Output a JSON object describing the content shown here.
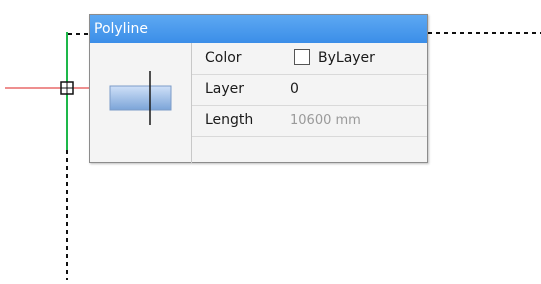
{
  "tooltip": {
    "title": "Polyline",
    "properties": [
      {
        "name": "Color",
        "value": "ByLayer",
        "swatch_color": "#ffffff"
      },
      {
        "name": "Layer",
        "value": "0"
      },
      {
        "name": "Length",
        "value": "10600 mm"
      }
    ]
  },
  "colors": {
    "header_accent": "#3b8ee8",
    "selected_polyline": "#1db84a",
    "red_axis": "#e86a6a",
    "dashed_line": "#111111"
  },
  "icons": {
    "thumbnail": "polyline-thumbnail-icon",
    "grip": "grip-handle-icon"
  }
}
